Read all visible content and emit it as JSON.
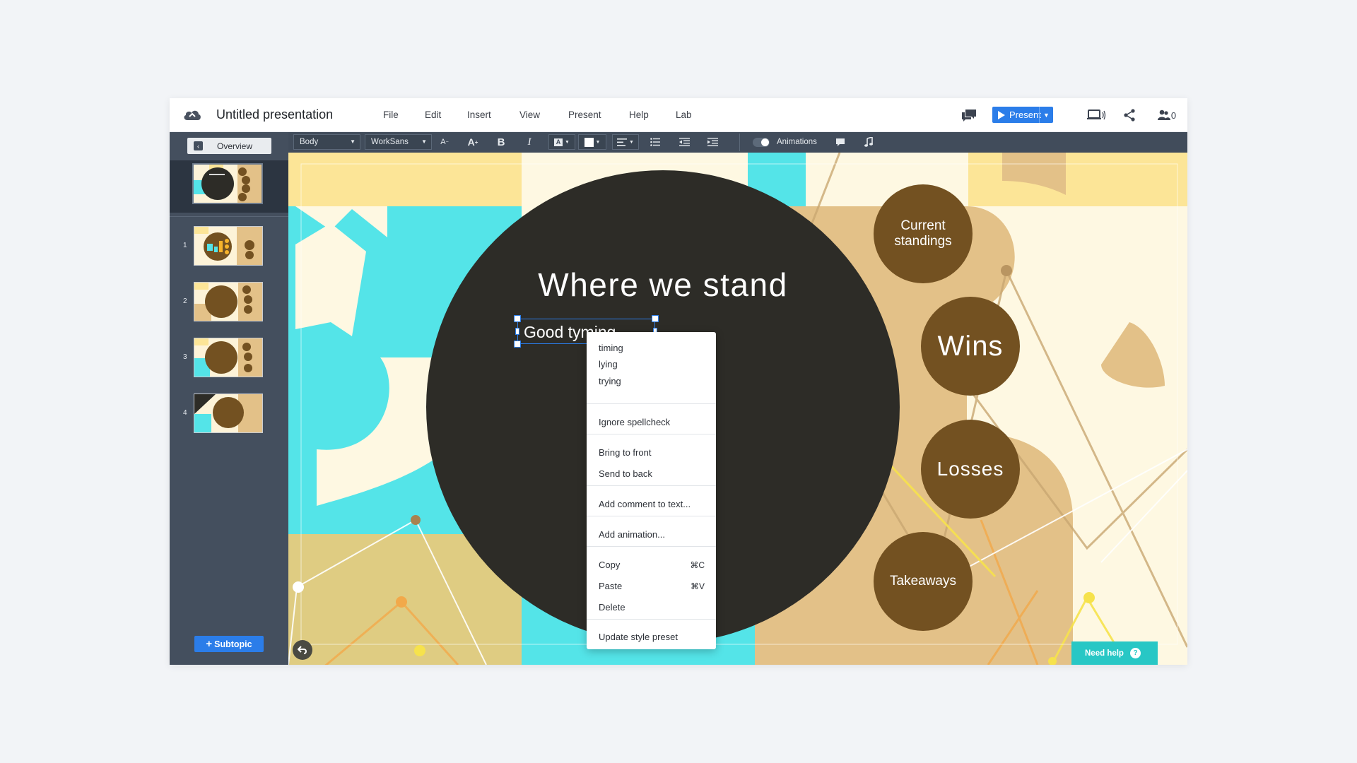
{
  "app": {
    "title": "Untitled presentation",
    "menu": [
      "File",
      "Edit",
      "Insert",
      "View",
      "Present",
      "Help",
      "Lab"
    ],
    "present_label": "Present",
    "collaborator_count": "0",
    "icons": [
      "cloud-icon",
      "comments-icon",
      "play-icon",
      "devices-icon",
      "share-icon",
      "collaborators-icon"
    ]
  },
  "sidebar": {
    "overview_label": "Overview",
    "thumbnails": [
      {
        "num": "1"
      },
      {
        "num": "2"
      },
      {
        "num": "3"
      },
      {
        "num": "4"
      }
    ],
    "subtopic_label": "Subtopic"
  },
  "toolbar": {
    "style_select": "Body",
    "font_select": "WorkSans",
    "animations_label": "Animations",
    "animations_on": true
  },
  "slide": {
    "title": "Where we stand",
    "subtitle": "Good tyming",
    "topics": [
      "Current standings",
      "Wins",
      "Losses",
      "Takeaways"
    ],
    "colors": {
      "dark_circle": "#2d2c27",
      "topic_circle": "#735121",
      "cyan": "#54e4e8",
      "yellow": "#fce597",
      "tan": "#e3c188",
      "cream": "#fef8e2"
    }
  },
  "context_menu": {
    "suggestions": [
      "timing",
      "lying",
      "trying"
    ],
    "ignore": "Ignore spellcheck",
    "arrange": [
      "Bring to front",
      "Send to back"
    ],
    "comment": "Add comment to text...",
    "animation": "Add animation...",
    "edit": [
      {
        "label": "Copy",
        "key": "⌘C"
      },
      {
        "label": "Paste",
        "key": "⌘V"
      },
      {
        "label": "Delete",
        "key": ""
      }
    ],
    "preset": "Update style preset"
  },
  "help": {
    "label": "Need help",
    "icon": "?"
  }
}
